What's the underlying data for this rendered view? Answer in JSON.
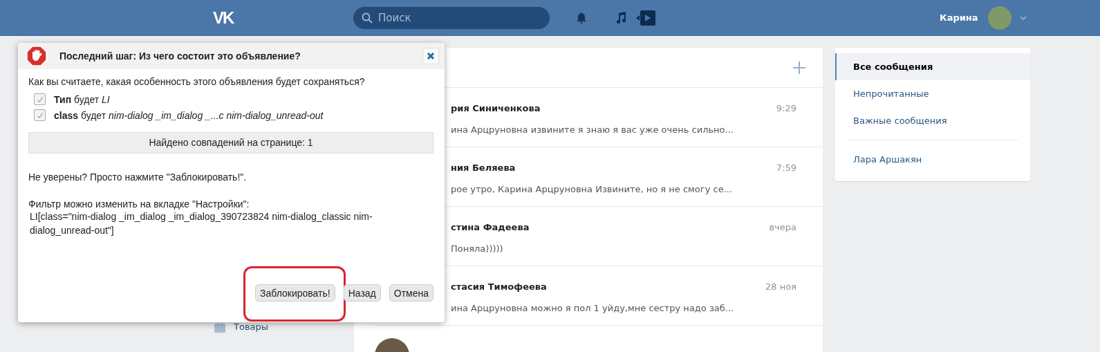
{
  "header": {
    "logo": "VK",
    "search": {
      "placeholder": "Поиск"
    },
    "user_name": "Карина"
  },
  "left_menu": [
    {
      "label": "Товары"
    }
  ],
  "messages": {
    "rows": [
      {
        "name": "рия Синиченкова",
        "time": "9:29",
        "preview": "ина Арцруновна извините я знаю я вас уже очень сильно..."
      },
      {
        "name": "ния Беляева",
        "time": "7:59",
        "preview": "рое утро, Карина Арцруновна Извините, но я не смогу се..."
      },
      {
        "name": "стина Фадеева",
        "time": "вчера",
        "preview": "Поняла)))))"
      },
      {
        "name": "стасия Тимофеева",
        "time": "28 ноя",
        "preview": "ина Арцруновна можно я пол 1 уйду,мне сестру надо заб..."
      }
    ]
  },
  "filters": {
    "items": [
      {
        "label": "Все сообщения",
        "selected": true
      },
      {
        "label": "Непрочитанные",
        "selected": false
      },
      {
        "label": "Важные сообщения",
        "selected": false
      }
    ],
    "contacts": [
      {
        "label": "Лара Аршакян"
      }
    ]
  },
  "dialog": {
    "title": "Последний шаг: Из чего состоит это объявление?",
    "question": "Как вы считаете, какая особенность этого объявления будет сохраняться?",
    "options": [
      {
        "text": "**Тип** будет *LI*",
        "checked": true
      },
      {
        "text": "**class** будет *nim-dialog _im_dialog _...c nim-dialog_unread-out*",
        "checked": true
      }
    ],
    "matches": "Найдено совпадений на странице: 1",
    "hint": "Не уверены? Просто нажмите \"Заблокировать!\".",
    "filter_label": "Фильтр можно изменить на вкладке \"Настройки\":",
    "filter_value": "LI[class=\"nim-dialog _im_dialog _im_dialog_390723824 nim-dialog_classic nim-dialog_unread-out\"]",
    "buttons": [
      {
        "label": "Заблокировать!",
        "highlighted": true
      },
      {
        "label": "Назад",
        "highlighted": false
      },
      {
        "label": "Отмена",
        "highlighted": false
      }
    ]
  }
}
